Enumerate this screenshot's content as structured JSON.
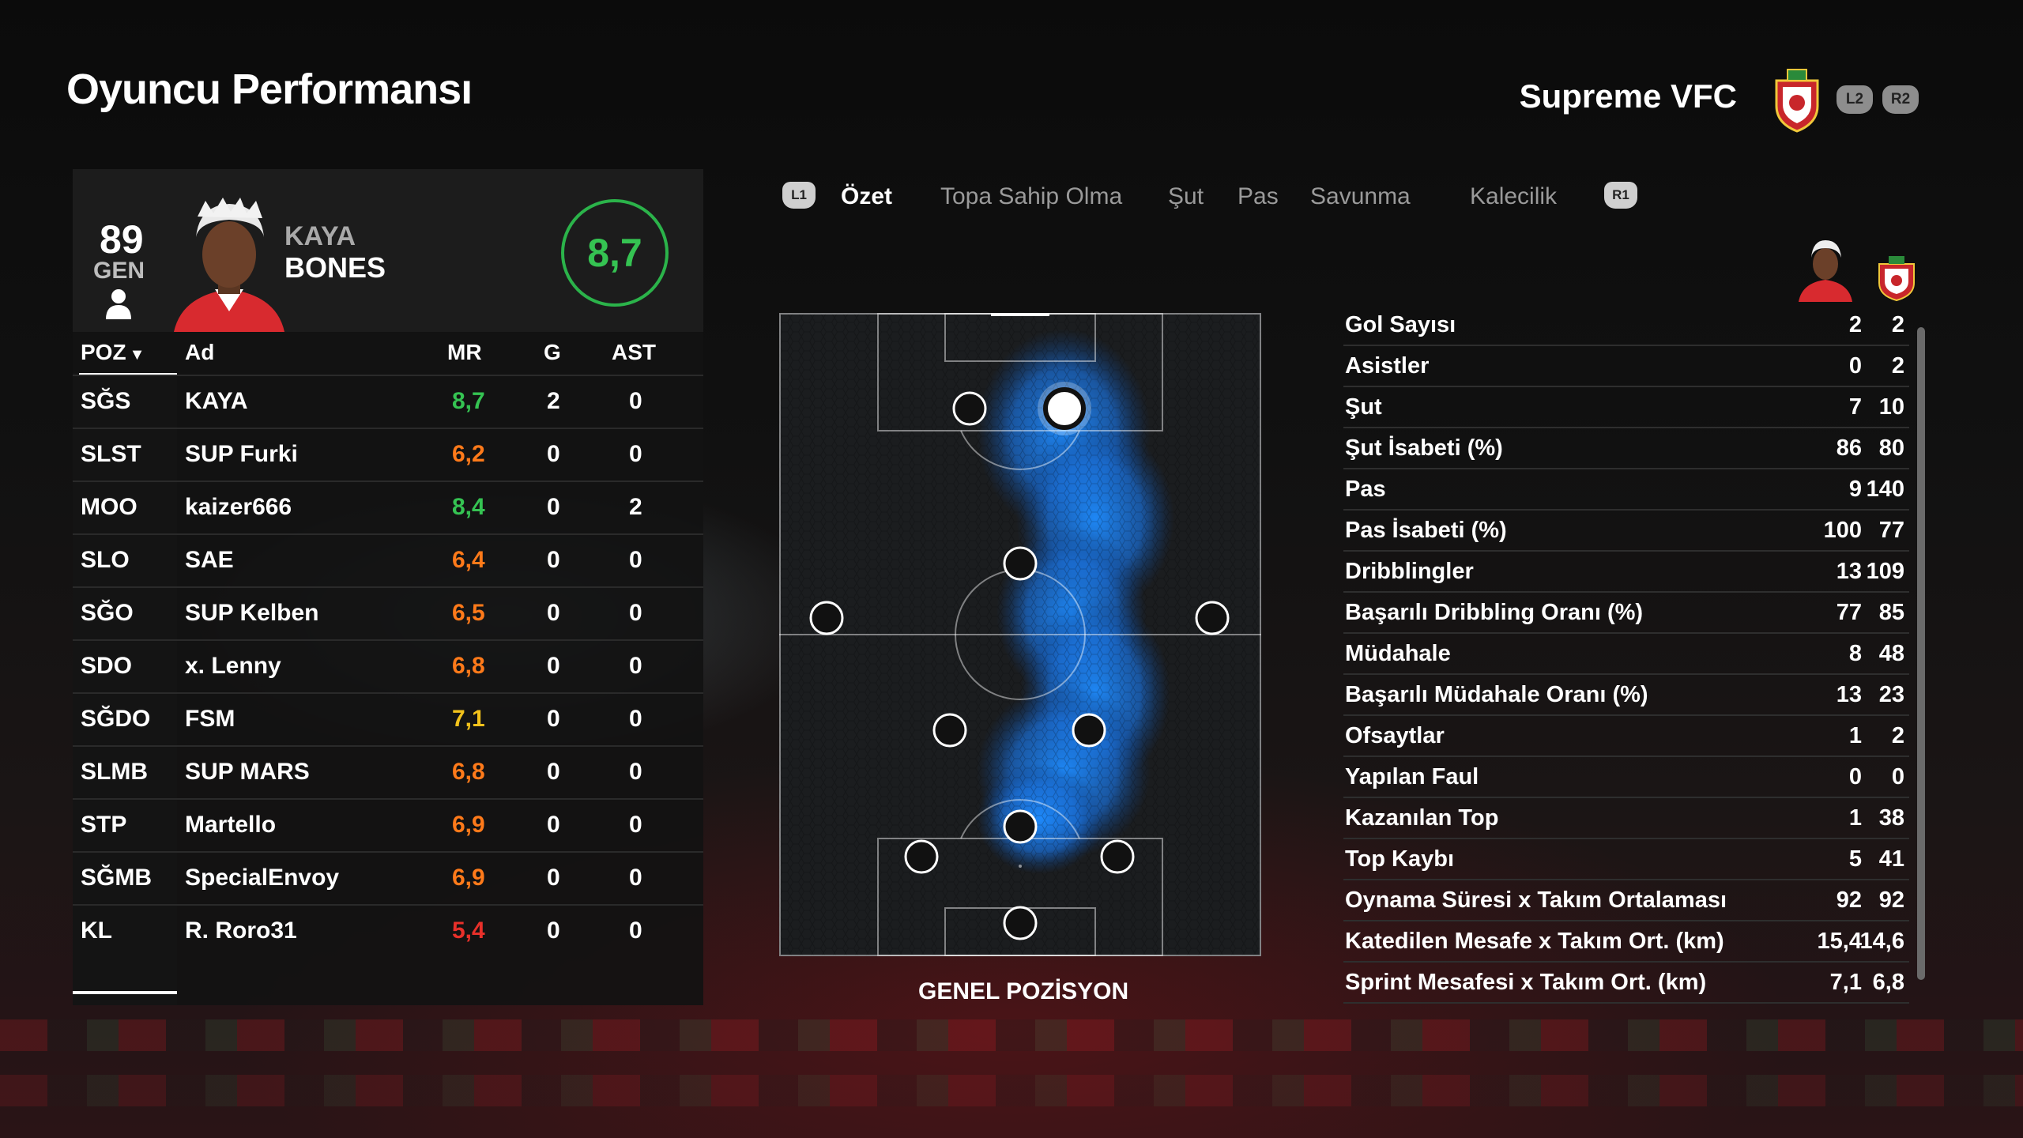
{
  "header": {
    "title": "Oyuncu Performansı",
    "club_name": "Supreme VFC",
    "l2_label": "L2",
    "r2_label": "R2"
  },
  "player": {
    "overall": "89",
    "overall_label": "GEN",
    "first_name": "KAYA",
    "last_name": "BONES",
    "match_rating": "8,7"
  },
  "table": {
    "headers": {
      "poz": "POZ",
      "name": "Ad",
      "mr": "MR",
      "g": "G",
      "ast": "AST"
    },
    "rows": [
      {
        "poz": "SĞS",
        "name": "KAYA",
        "mr": "8,7",
        "g": "2",
        "ast": "0",
        "mr_color": "#35c352"
      },
      {
        "poz": "SLST",
        "name": "SUP Furki",
        "mr": "6,2",
        "g": "0",
        "ast": "0",
        "mr_color": "#ff7a1a"
      },
      {
        "poz": "MOO",
        "name": "kaizer666",
        "mr": "8,4",
        "g": "0",
        "ast": "2",
        "mr_color": "#35c352"
      },
      {
        "poz": "SLO",
        "name": "SAE",
        "mr": "6,4",
        "g": "0",
        "ast": "0",
        "mr_color": "#ff7a1a"
      },
      {
        "poz": "SĞO",
        "name": "SUP Kelben",
        "mr": "6,5",
        "g": "0",
        "ast": "0",
        "mr_color": "#ff7a1a"
      },
      {
        "poz": "SDO",
        "name": "x. Lenny",
        "mr": "6,8",
        "g": "0",
        "ast": "0",
        "mr_color": "#ff7a1a"
      },
      {
        "poz": "SĞDO",
        "name": "FSM",
        "mr": "7,1",
        "g": "0",
        "ast": "0",
        "mr_color": "#f2c21b"
      },
      {
        "poz": "SLMB",
        "name": "SUP MARS",
        "mr": "6,8",
        "g": "0",
        "ast": "0",
        "mr_color": "#ff7a1a"
      },
      {
        "poz": "STP",
        "name": "Martello",
        "mr": "6,9",
        "g": "0",
        "ast": "0",
        "mr_color": "#ff7a1a"
      },
      {
        "poz": "SĞMB",
        "name": "SpecialEnvoy",
        "mr": "6,9",
        "g": "0",
        "ast": "0",
        "mr_color": "#ff7a1a"
      },
      {
        "poz": "KL",
        "name": "R. Roro31",
        "mr": "5,4",
        "g": "0",
        "ast": "0",
        "mr_color": "#e8302a"
      }
    ]
  },
  "tabs": {
    "l1": "L1",
    "r1": "R1",
    "items": [
      "Özet",
      "Topa Sahip Olma",
      "Şut",
      "Pas",
      "Savunma",
      "Kalecilik"
    ],
    "active_index": 0
  },
  "pitch": {
    "label": "GENEL POZİSYON"
  },
  "stats": [
    {
      "label": "Gol Sayısı",
      "player": "2",
      "team": "2"
    },
    {
      "label": "Asistler",
      "player": "0",
      "team": "2"
    },
    {
      "label": "Şut",
      "player": "7",
      "team": "10"
    },
    {
      "label": "Şut İsabeti (%)",
      "player": "86",
      "team": "80"
    },
    {
      "label": "Pas",
      "player": "9",
      "team": "140"
    },
    {
      "label": "Pas İsabeti (%)",
      "player": "100",
      "team": "77"
    },
    {
      "label": "Dribblingler",
      "player": "13",
      "team": "109"
    },
    {
      "label": "Başarılı Dribbling Oranı (%)",
      "player": "77",
      "team": "85"
    },
    {
      "label": "Müdahale",
      "player": "8",
      "team": "48"
    },
    {
      "label": "Başarılı Müdahale Oranı (%)",
      "player": "13",
      "team": "23"
    },
    {
      "label": "Ofsaytlar",
      "player": "1",
      "team": "2"
    },
    {
      "label": "Yapılan Faul",
      "player": "0",
      "team": "0"
    },
    {
      "label": "Kazanılan Top",
      "player": "1",
      "team": "38"
    },
    {
      "label": "Top Kaybı",
      "player": "5",
      "team": "41"
    },
    {
      "label": "Oynama Süresi x Takım Ortalaması",
      "player": "92",
      "team": "92"
    },
    {
      "label": "Katedilen Mesafe x Takım Ort. (km)",
      "player": "15,4",
      "team": "14,6"
    },
    {
      "label": "Sprint Mesafesi x Takım Ort. (km)",
      "player": "7,1",
      "team": "6,8"
    }
  ],
  "colors": {
    "accent_green": "#35c352",
    "heatmap_blue": "#1e8cff"
  }
}
